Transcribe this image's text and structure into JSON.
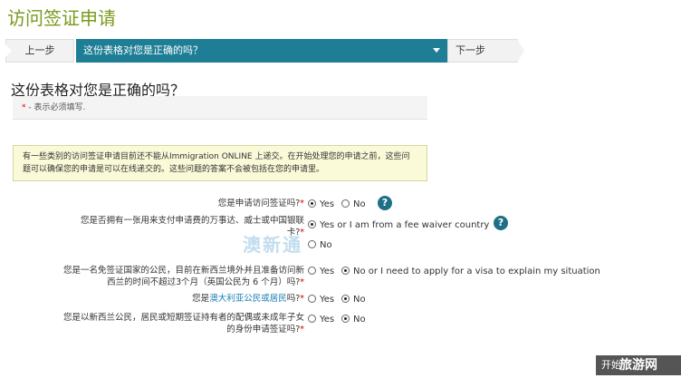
{
  "page_title": "访问签证申请",
  "steps": {
    "prev_label": "上一步",
    "current_label": "这份表格对您是正确的吗？",
    "next_label": "下一步"
  },
  "section_heading": "这份表格对您是正确的吗？",
  "required_note": {
    "star": "*",
    "text": " - 表示必须填写."
  },
  "notice_text": "有一些类别的访问签证申请目前还不能从Immigration ONLINE 上递交。在开始处理您的申请之前，这些问题可以确保您的申请是可以在线递交的。这些问题的答案不会被包括在您的申请里。",
  "questions": [
    {
      "text": "您是申请访问签证吗?",
      "star": "*",
      "options": [
        {
          "label": "Yes",
          "selected": true
        },
        {
          "label": "No",
          "selected": false
        }
      ]
    },
    {
      "text": "您是否拥有一张用来支付申请费的万事达、威士或中国银联卡?",
      "star": "*",
      "options": [
        {
          "label": "Yes or I am from a fee waiver country",
          "selected": true
        },
        {
          "label": "No",
          "selected": false
        }
      ]
    },
    {
      "text": "您是一名免签证国家的公民，目前在新西兰境外并且准备访问新西兰的时间不超过3个月（英国公民为 6 个月）吗?",
      "star": "*",
      "options": [
        {
          "label": "Yes",
          "selected": false
        },
        {
          "label": "No or I need to apply for a visa to explain my situation",
          "selected": true
        }
      ]
    },
    {
      "text_prefix": "您是",
      "text_highlight": "澳大利亚公民或居民",
      "text_suffix": "吗?",
      "star": "*",
      "options": [
        {
          "label": "Yes",
          "selected": false
        },
        {
          "label": "No",
          "selected": true
        }
      ]
    },
    {
      "text": "您是以新西兰公民，居民或短期签证持有者的配偶或未成年子女的身份申请签证吗?",
      "star": "*",
      "options": [
        {
          "label": "Yes",
          "selected": false
        },
        {
          "label": "No",
          "selected": true
        }
      ]
    }
  ],
  "help_icon_glyph": "?",
  "watermark_text": "澳新通",
  "bottom_button": {
    "label": "开始",
    "watermark": "旅游网"
  },
  "colors": {
    "title": "#7a9a1e",
    "step_active": "#1e7e96",
    "help_icon": "#1f6f86",
    "required_star": "#dd0000",
    "notice_bg": "#fafad8"
  }
}
